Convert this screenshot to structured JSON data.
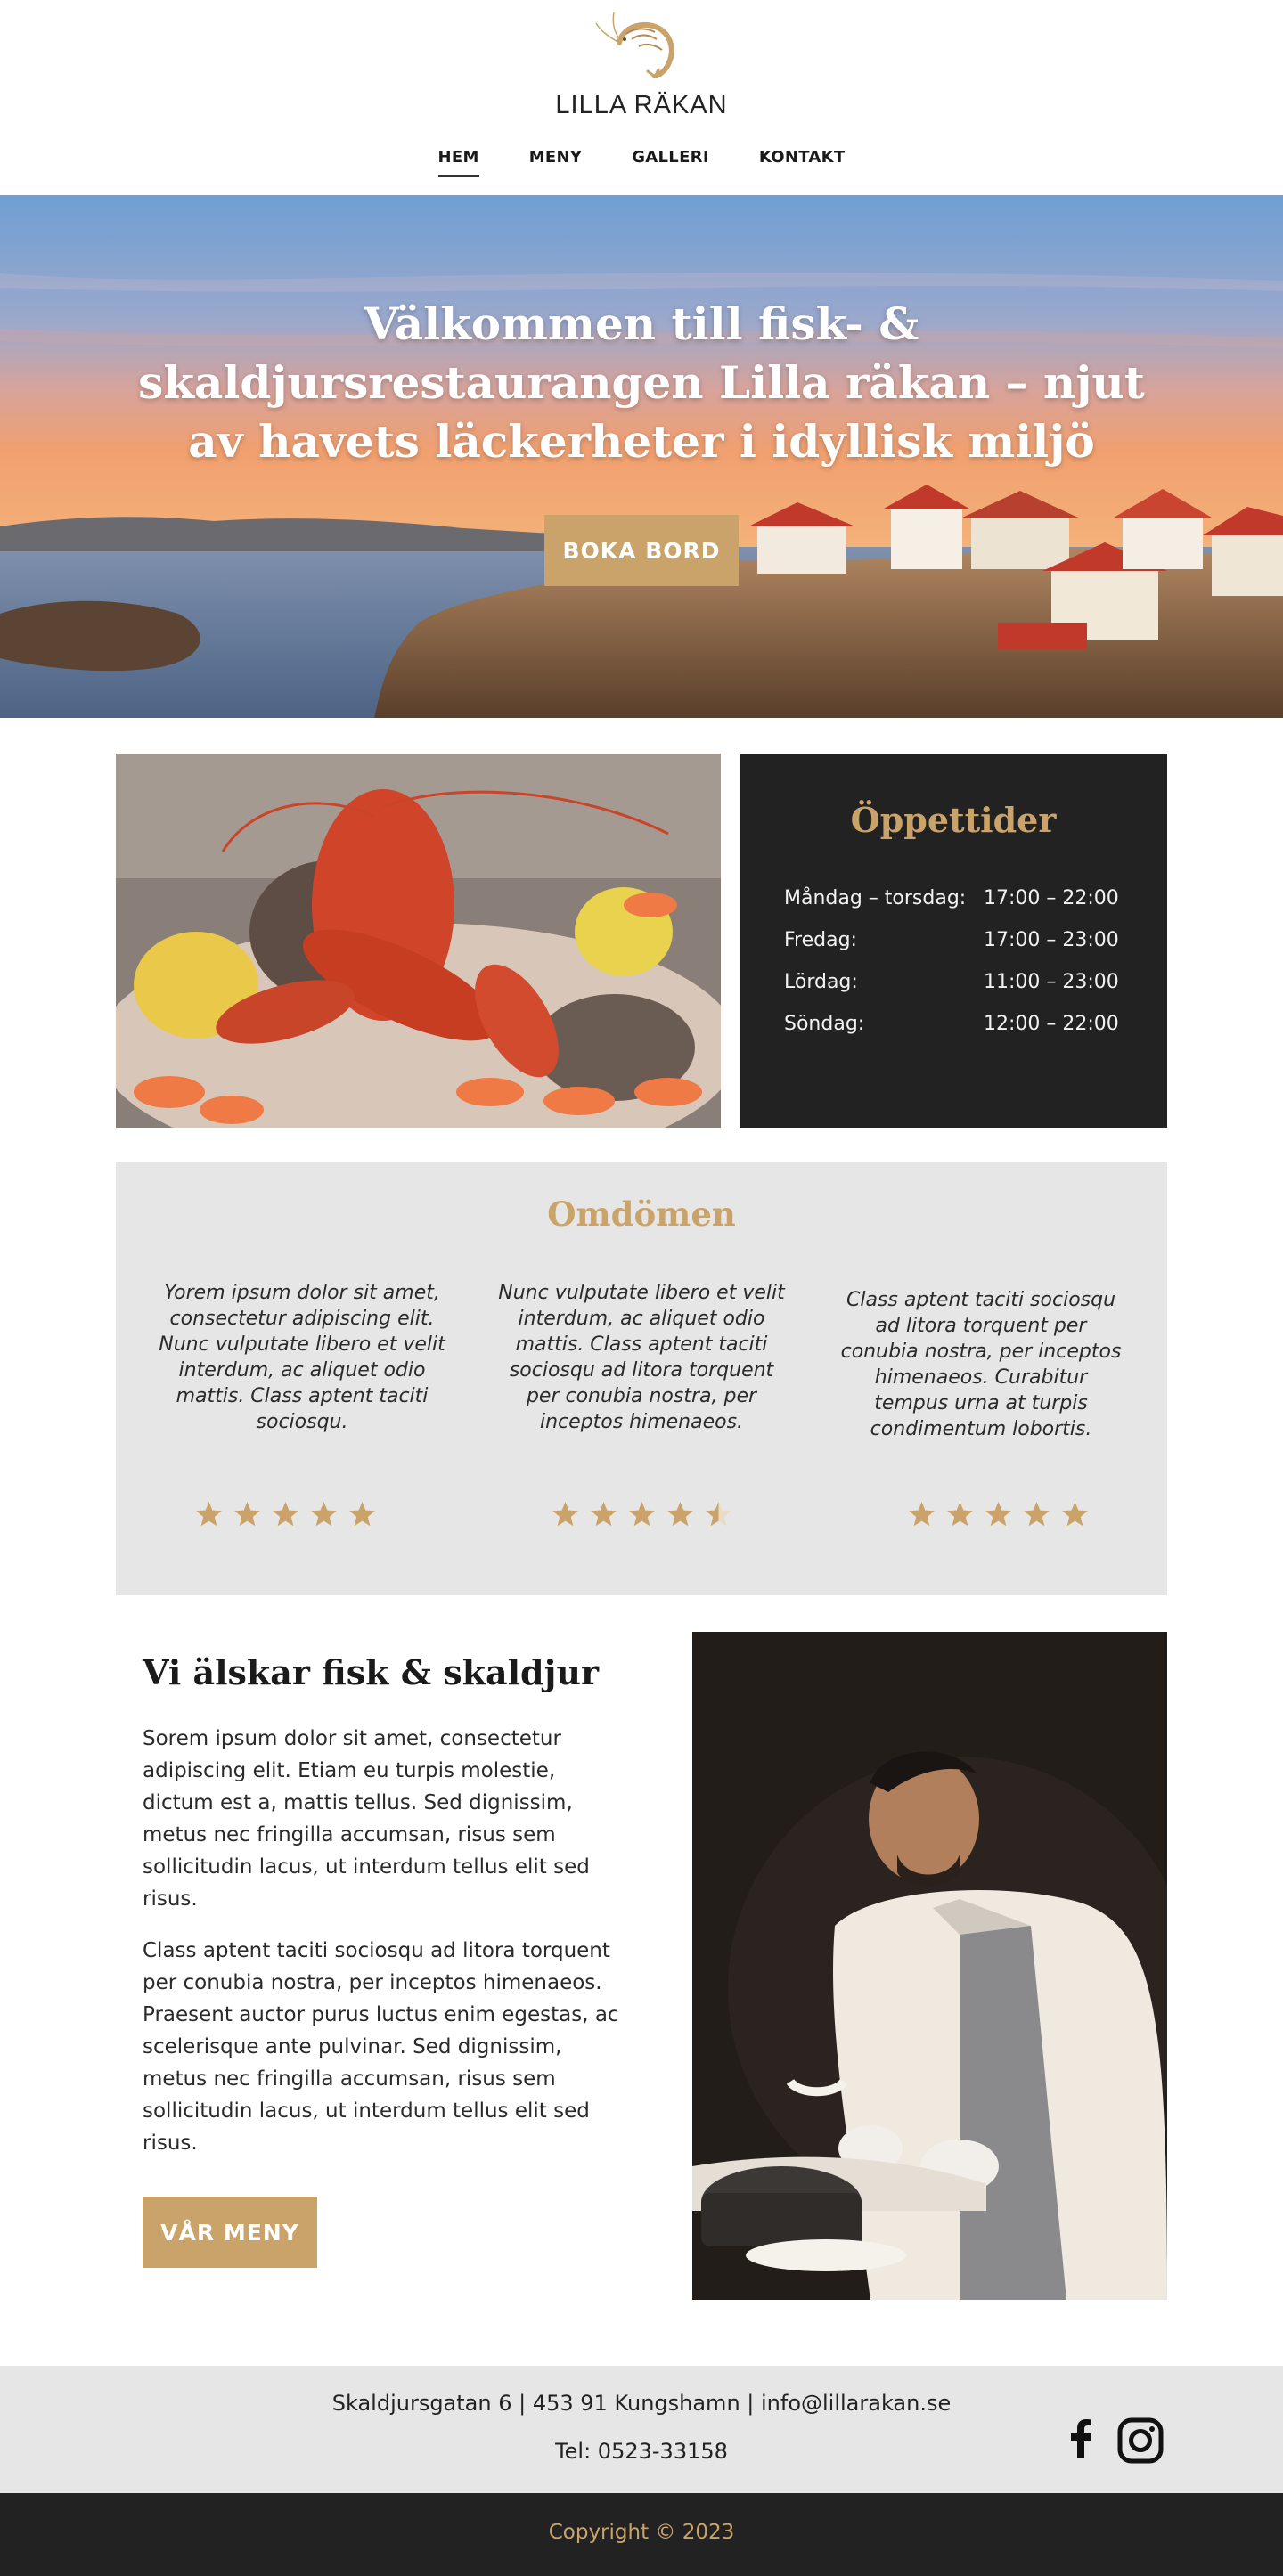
{
  "brand": {
    "name": "LILLA RÄKAN",
    "logo_icon": "shrimp-icon"
  },
  "nav": {
    "items": [
      {
        "label": "HEM",
        "active": true
      },
      {
        "label": "MENY",
        "active": false
      },
      {
        "label": "GALLERI",
        "active": false
      },
      {
        "label": "KONTAKT",
        "active": false
      }
    ]
  },
  "hero": {
    "title": "Välkommen till fisk- & skaldjursrestaurangen Lilla räkan – njut av havets läckerheter i idyllisk miljö",
    "button_label": "BOKA BORD"
  },
  "hours": {
    "title": "Öppettider",
    "rows": [
      {
        "day": "Måndag – torsdag:",
        "time": "17:00 – 22:00"
      },
      {
        "day": "Fredag:",
        "time": "17:00 – 23:00"
      },
      {
        "day": "Lördag:",
        "time": "11:00 – 23:00"
      },
      {
        "day": "Söndag:",
        "time": "12:00 – 22:00"
      }
    ]
  },
  "reviews": {
    "title": "Omdömen",
    "items": [
      {
        "text": "Yorem ipsum dolor sit amet, consectetur adipiscing elit. Nunc vulputate libero et velit interdum, ac aliquet odio mattis. Class aptent taciti sociosqu.",
        "rating": 5
      },
      {
        "text": "Nunc vulputate libero et velit interdum, ac aliquet odio mattis. Class aptent taciti sociosqu ad litora torquent per conubia nostra, per inceptos himenaeos.",
        "rating": 4.5
      },
      {
        "text": "Class aptent taciti sociosqu ad litora torquent per conubia nostra, per inceptos himenaeos. Curabitur tempus urna at turpis condimentum lobortis.",
        "rating": 5
      }
    ]
  },
  "about": {
    "title": "Vi älskar fisk & skaldjur",
    "paragraphs": [
      "Sorem ipsum dolor sit amet, consectetur adipiscing elit. Etiam eu turpis molestie, dictum est a, mattis tellus. Sed dignissim, metus nec fringilla accumsan, risus sem sollicitudin lacus, ut interdum tellus elit sed risus.",
      "Class aptent taciti sociosqu ad litora torquent per conubia nostra, per inceptos himenaeos. Praesent auctor purus luctus enim egestas, ac scelerisque ante pulvinar. Sed dignissim, metus nec fringilla accumsan, risus sem sollicitudin lacus, ut interdum tellus elit sed risus."
    ],
    "button_label": "VÅR MENY"
  },
  "footer": {
    "address": "Skaldjursgatan 6 | 453 91 Kungshamn | info@lillarakan.se",
    "phone": "Tel:  0523-33158",
    "social_icons": [
      "facebook-icon",
      "instagram-icon"
    ],
    "copyright": "Copyright © 2023"
  },
  "colors": {
    "accent": "#c9a36a",
    "dark": "#222222",
    "light_gray": "#e6e6e6"
  }
}
